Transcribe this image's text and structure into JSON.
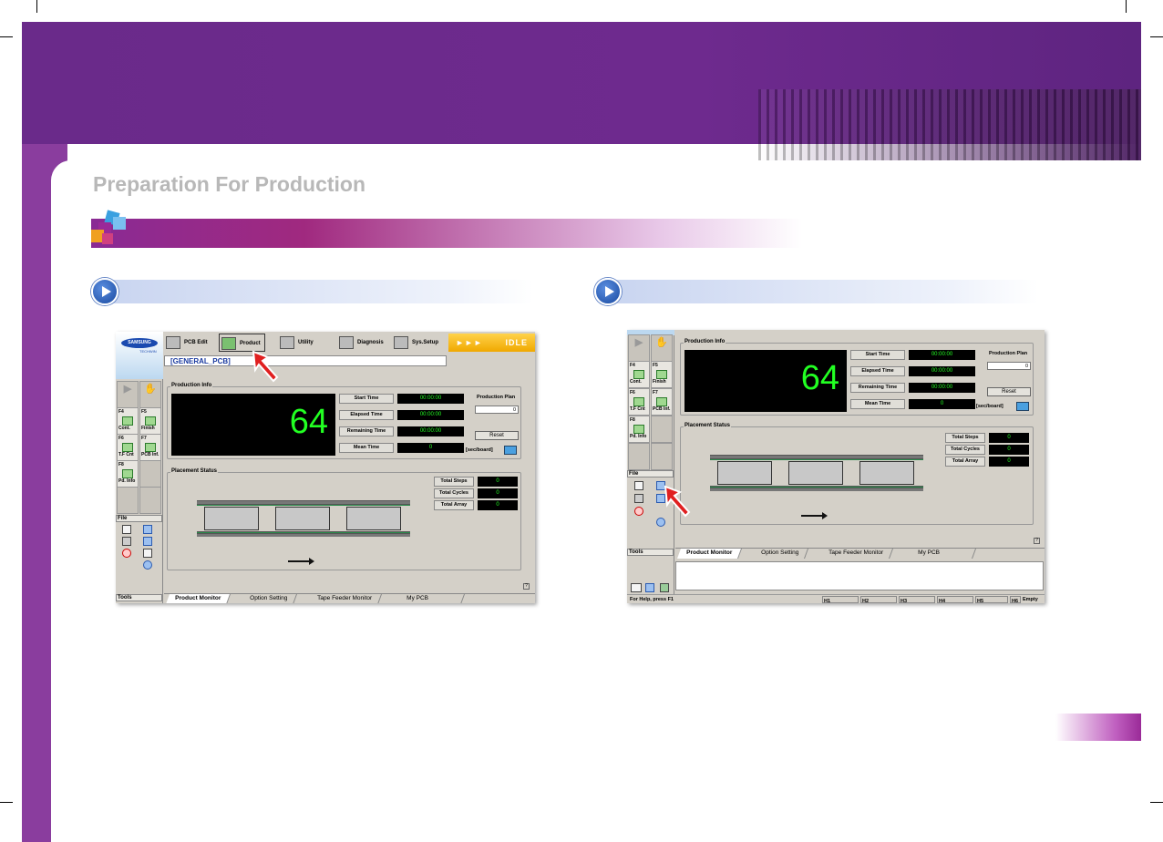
{
  "page": {
    "title": "Preparation For Production"
  },
  "left_screen": {
    "logo_line1": "SAMSUNG",
    "logo_line2": "TECHWIN",
    "toolbar": {
      "pcb_edit": "PCB Edit",
      "product": "Product",
      "utility": "Utility",
      "diagnosis": "Diagnosis",
      "sys_setup": "Sys.Setup",
      "status_arrows": "►►►",
      "status": "IDLE"
    },
    "pcb_name": "[GENERAL_PCB]",
    "side_buttons": [
      {
        "key": "F4",
        "label": "Cont."
      },
      {
        "key": "F5",
        "label": "Finish"
      },
      {
        "key": "F6",
        "label": "T.F Cnt"
      },
      {
        "key": "F7",
        "label": "PCB Inf."
      },
      {
        "key": "F8",
        "label": "Pd. Info"
      }
    ],
    "file_label": "File",
    "tools_label": "Tools",
    "production_info": {
      "label": "Production Info",
      "count": "64",
      "rows": [
        {
          "label": "Start Time",
          "value": "00:00:00"
        },
        {
          "label": "Elapsed Time",
          "value": "00:00:00"
        },
        {
          "label": "Remaining Time",
          "value": "00:00:00"
        },
        {
          "label": "Mean Time",
          "value": "0"
        }
      ],
      "plan_label": "Production Plan",
      "plan_value": "0",
      "reset": "Reset",
      "unit": "[sec/board]"
    },
    "placement_status": {
      "label": "Placement Status",
      "rows": [
        {
          "label": "Total Steps",
          "value": "0"
        },
        {
          "label": "Total Cycles",
          "value": "0"
        },
        {
          "label": "Total Array",
          "value": "0"
        }
      ]
    },
    "tabs": [
      "Product Monitor",
      "Option Setting",
      "Tape Feeder Monitor",
      "My PCB"
    ],
    "help": "?"
  },
  "right_screen": {
    "side_buttons": [
      {
        "key": "F4",
        "label": "Cont."
      },
      {
        "key": "F5",
        "label": "Finish"
      },
      {
        "key": "F6",
        "label": "T.F Cnt"
      },
      {
        "key": "F7",
        "label": "PCB Inf."
      },
      {
        "key": "F8",
        "label": "Pd. Info"
      }
    ],
    "file_label": "File",
    "tools_label": "Tools",
    "production_info": {
      "label": "Production Info",
      "count": "64",
      "rows": [
        {
          "label": "Start Time",
          "value": "00:00:00"
        },
        {
          "label": "Elapsed Time",
          "value": "00:00:00"
        },
        {
          "label": "Remaining Time",
          "value": "00:00:00"
        },
        {
          "label": "Mean Time",
          "value": "0"
        }
      ],
      "plan_label": "Production Plan",
      "plan_value": "0",
      "reset": "Reset",
      "unit": "[sec/board]"
    },
    "placement_status": {
      "label": "Placement Status",
      "rows": [
        {
          "label": "Total Steps",
          "value": "0"
        },
        {
          "label": "Total Cycles",
          "value": "0"
        },
        {
          "label": "Total Array",
          "value": "0"
        }
      ]
    },
    "tabs": [
      "Product Monitor",
      "Option Setting",
      "Tape Feeder Monitor",
      "My PCB"
    ],
    "help": "?",
    "statusbar": {
      "help": "For Help, press F1",
      "h1": "H1",
      "h2": "H2",
      "h3": "H3",
      "h4": "H4",
      "h5": "H5",
      "h6": "H6",
      "empty": "Empty"
    }
  },
  "colors": {
    "banner": "#6a2a8a",
    "digits": "#22ff22",
    "idle": "#f0a800"
  }
}
